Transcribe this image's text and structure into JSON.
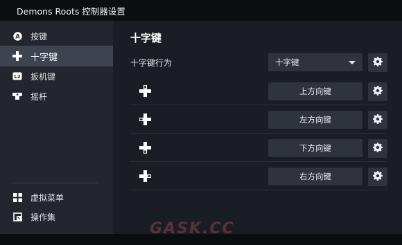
{
  "window": {
    "title": "Demons Roots 控制器设置"
  },
  "sidebar": {
    "items": [
      {
        "label": "按键",
        "icon": "a-button-icon",
        "active": false
      },
      {
        "label": "十字键",
        "icon": "dpad-icon",
        "active": true
      },
      {
        "label": "扳机键",
        "icon": "trigger-icon",
        "active": false
      },
      {
        "label": "摇杆",
        "icon": "joystick-icon",
        "active": false
      }
    ],
    "bottom_items": [
      {
        "label": "虚拟菜单",
        "icon": "grid-menu-icon"
      },
      {
        "label": "操作集",
        "icon": "action-set-icon"
      }
    ]
  },
  "main": {
    "title": "十字键",
    "behavior": {
      "label": "十字键行为",
      "value": "十字键"
    },
    "bindings": [
      {
        "direction": "up",
        "icon": "dpad-up-icon",
        "label": "上方向键"
      },
      {
        "direction": "left",
        "icon": "dpad-left-icon",
        "label": "左方向键"
      },
      {
        "direction": "down",
        "icon": "dpad-down-icon",
        "label": "下方向键"
      },
      {
        "direction": "right",
        "icon": "dpad-right-icon",
        "label": "右方向键"
      }
    ]
  },
  "watermark": "GASK.CC"
}
